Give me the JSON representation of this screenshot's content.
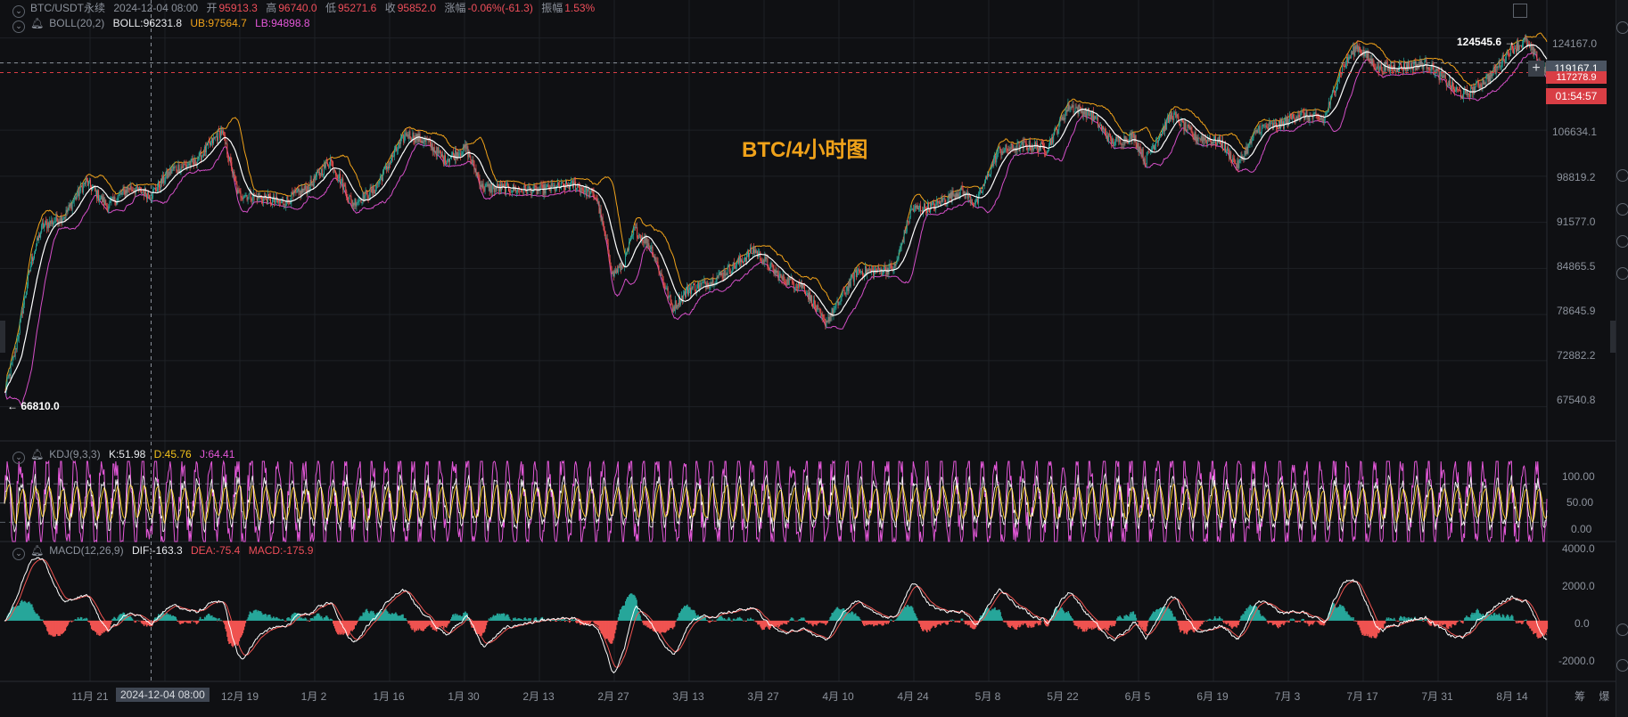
{
  "colors": {
    "up": "#26a69a",
    "down": "#ef5350",
    "mid": "#ffffff",
    "upper": "#f0a21a",
    "lower": "#d44fc7",
    "k": "#ffffff",
    "d": "#f2c21b",
    "j": "#e357d8",
    "dif": "#ffffff",
    "dea": "#ef5350",
    "hist_up": "#26a69a",
    "hist_down": "#ef5350",
    "bg": "#0f1013",
    "grid": "#1e2126"
  },
  "header": {
    "symbol": "BTC/USDT永续",
    "datetime": "2024-12-04 08:00",
    "open_label": "开",
    "open": "95913.3",
    "high_label": "高",
    "high": "96740.0",
    "low_label": "低",
    "low": "95271.6",
    "close_label": "收",
    "close": "95852.0",
    "change_label": "涨幅",
    "change": "-0.06%(-61.3)",
    "amp_label": "振幅",
    "amp": "1.53%"
  },
  "boll": {
    "name": "BOLL(20,2)",
    "mid": "BOLL:96231.8",
    "ub": "UB:97564.7",
    "lb": "LB:94898.8"
  },
  "kdj": {
    "name": "KDJ(9,3,3)",
    "k": "K:51.98",
    "d": "D:45.76",
    "j": "J:64.41"
  },
  "macd": {
    "name": "MACD(12,26,9)",
    "dif": "DIF:-163.3",
    "dea": "DEA:-75.4",
    "macd": "MACD:-175.9"
  },
  "watermark": "BTC/4小时图",
  "price_axis": [
    "124167.0",
    "119167.1",
    "106634.1",
    "98819.2",
    "91577.0",
    "84865.5",
    "78645.9",
    "72882.2",
    "67540.8"
  ],
  "price_tags": {
    "current": "119167.1",
    "last": "117278.9",
    "countdown": "01:54:57"
  },
  "high_marker": "124545.6 →",
  "low_marker": "← 66810.0",
  "kdj_axis": [
    "100.00",
    "50.00",
    "0.00"
  ],
  "macd_axis": [
    "4000.0",
    "2000.0",
    "0.0",
    "-2000.0"
  ],
  "x_labels": [
    "11月 21",
    "12月 19",
    "1月 2",
    "1月 16",
    "1月 30",
    "2月 13",
    "2月 27",
    "3月 13",
    "3月 27",
    "4月 10",
    "4月 24",
    "5月 8",
    "5月 22",
    "6月 5",
    "6月 19",
    "7月 3",
    "7月 17",
    "7月 31",
    "8月 14"
  ],
  "cursor_date": "2024-12-04 08:00",
  "corner_label": "筹 爆",
  "chart_data": {
    "type": "candlestick",
    "title": "BTC/4小时图",
    "interval": "4h",
    "x_range": [
      "2024-11-07",
      "2025-08-18"
    ],
    "ylim": [
      64500,
      126500
    ],
    "log_scale": true,
    "price_anchors": [
      {
        "date": "2024-11-07",
        "value": 69000
      },
      {
        "date": "2024-11-09",
        "value": 74000
      },
      {
        "date": "2024-11-12",
        "value": 86000
      },
      {
        "date": "2024-11-14",
        "value": 91000
      },
      {
        "date": "2024-11-18",
        "value": 92500
      },
      {
        "date": "2024-11-22",
        "value": 98000
      },
      {
        "date": "2024-11-26",
        "value": 94000
      },
      {
        "date": "2024-11-30",
        "value": 97000
      },
      {
        "date": "2024-12-04",
        "value": 95900
      },
      {
        "date": "2024-12-08",
        "value": 100000
      },
      {
        "date": "2024-12-12",
        "value": 101000
      },
      {
        "date": "2024-12-17",
        "value": 106500
      },
      {
        "date": "2024-12-20",
        "value": 96000
      },
      {
        "date": "2024-12-24",
        "value": 95500
      },
      {
        "date": "2024-12-28",
        "value": 94500
      },
      {
        "date": "2025-01-02",
        "value": 97000
      },
      {
        "date": "2025-01-06",
        "value": 101500
      },
      {
        "date": "2025-01-10",
        "value": 94500
      },
      {
        "date": "2025-01-14",
        "value": 96500
      },
      {
        "date": "2025-01-20",
        "value": 106000
      },
      {
        "date": "2025-01-24",
        "value": 104500
      },
      {
        "date": "2025-01-27",
        "value": 101500
      },
      {
        "date": "2025-01-31",
        "value": 103500
      },
      {
        "date": "2025-02-03",
        "value": 97000
      },
      {
        "date": "2025-02-08",
        "value": 96800
      },
      {
        "date": "2025-02-13",
        "value": 96500
      },
      {
        "date": "2025-02-20",
        "value": 97500
      },
      {
        "date": "2025-02-24",
        "value": 95500
      },
      {
        "date": "2025-02-27",
        "value": 84000
      },
      {
        "date": "2025-03-01",
        "value": 85500
      },
      {
        "date": "2025-03-03",
        "value": 90500
      },
      {
        "date": "2025-03-06",
        "value": 88000
      },
      {
        "date": "2025-03-10",
        "value": 79500
      },
      {
        "date": "2025-03-13",
        "value": 82000
      },
      {
        "date": "2025-03-17",
        "value": 83000
      },
      {
        "date": "2025-03-21",
        "value": 85000
      },
      {
        "date": "2025-03-25",
        "value": 87500
      },
      {
        "date": "2025-03-30",
        "value": 83500
      },
      {
        "date": "2025-04-03",
        "value": 82500
      },
      {
        "date": "2025-04-07",
        "value": 77500
      },
      {
        "date": "2025-04-09",
        "value": 79500
      },
      {
        "date": "2025-04-13",
        "value": 84500
      },
      {
        "date": "2025-04-17",
        "value": 84500
      },
      {
        "date": "2025-04-20",
        "value": 85000
      },
      {
        "date": "2025-04-23",
        "value": 93500
      },
      {
        "date": "2025-04-27",
        "value": 94000
      },
      {
        "date": "2025-05-02",
        "value": 96500
      },
      {
        "date": "2025-05-05",
        "value": 94500
      },
      {
        "date": "2025-05-09",
        "value": 103000
      },
      {
        "date": "2025-05-14",
        "value": 104000
      },
      {
        "date": "2025-05-18",
        "value": 103500
      },
      {
        "date": "2025-05-22",
        "value": 111000
      },
      {
        "date": "2025-05-26",
        "value": 109500
      },
      {
        "date": "2025-05-30",
        "value": 104500
      },
      {
        "date": "2025-06-03",
        "value": 105500
      },
      {
        "date": "2025-06-05",
        "value": 101500
      },
      {
        "date": "2025-06-10",
        "value": 109500
      },
      {
        "date": "2025-06-14",
        "value": 105500
      },
      {
        "date": "2025-06-19",
        "value": 104500
      },
      {
        "date": "2025-06-22",
        "value": 100500
      },
      {
        "date": "2025-06-26",
        "value": 107000
      },
      {
        "date": "2025-06-30",
        "value": 107500
      },
      {
        "date": "2025-07-03",
        "value": 109500
      },
      {
        "date": "2025-07-08",
        "value": 108500
      },
      {
        "date": "2025-07-11",
        "value": 117500
      },
      {
        "date": "2025-07-14",
        "value": 122500
      },
      {
        "date": "2025-07-18",
        "value": 118000
      },
      {
        "date": "2025-07-23",
        "value": 118500
      },
      {
        "date": "2025-07-27",
        "value": 119000
      },
      {
        "date": "2025-08-01",
        "value": 114000
      },
      {
        "date": "2025-08-03",
        "value": 113000
      },
      {
        "date": "2025-08-08",
        "value": 117000
      },
      {
        "date": "2025-08-11",
        "value": 121500
      },
      {
        "date": "2025-08-14",
        "value": 123500
      },
      {
        "date": "2025-08-18",
        "value": 117300
      }
    ],
    "high": {
      "value": 124545.6,
      "date": "2025-08-14"
    },
    "low": {
      "value": 66810.0,
      "date": "2024-11-07"
    },
    "indicators": [
      "BOLL(20,2)",
      "KDJ(9,3,3)",
      "MACD(12,26,9)"
    ],
    "kdj_ylim": [
      -10,
      115
    ],
    "macd_ylim": [
      -3200,
      4300
    ],
    "legend": "top-left"
  }
}
